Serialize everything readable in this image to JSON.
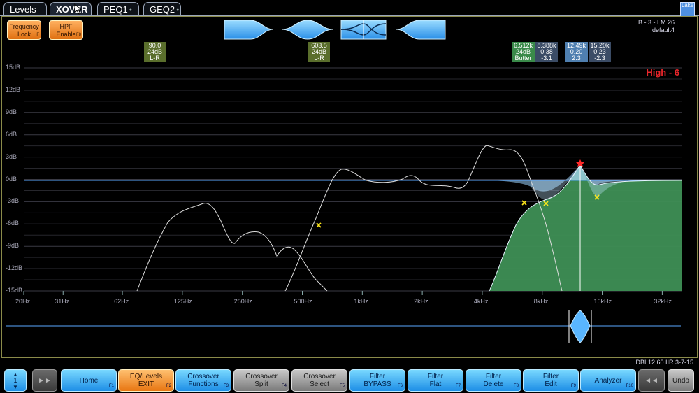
{
  "tabs": [
    {
      "label": "Levels",
      "active": false,
      "dot": false
    },
    {
      "label": "XOVER",
      "active": true,
      "dot": false
    },
    {
      "label": "PEQ1",
      "active": false,
      "dot": true
    },
    {
      "label": "GEQ2",
      "active": false,
      "dot": true
    }
  ],
  "logo_text": "Lake",
  "top_buttons": {
    "freq_lock": {
      "line1": "Frequency",
      "line2": "Lock",
      "fkey": "F"
    },
    "hpf_enable": {
      "line1": "HPF",
      "line2": "Enable",
      "fkey": "F8"
    }
  },
  "module_info": {
    "name": "B - 3 - LM 26",
    "preset": "default4"
  },
  "high_label": "High - 6",
  "crossover_boxes": [
    {
      "l1": "90.0",
      "l2": "24dB",
      "l3": "L-R"
    },
    {
      "l1": "603.5",
      "l2": "24dB",
      "l3": "L-R"
    },
    {
      "l1": "6.512k",
      "l2": "24dB",
      "l3": "Butter"
    },
    {
      "l1": "8.388k",
      "l2": "0.38",
      "l3": "-3.1"
    },
    {
      "l1": "12.49k",
      "l2": "0.20",
      "l3": "2.3"
    },
    {
      "l1": "15.20k",
      "l2": "0.23",
      "l3": "-2.3"
    }
  ],
  "y_axis_labels": [
    "15dB",
    "12dB",
    "9dB",
    "6dB",
    "3dB",
    "0dB",
    "-3dB",
    "-6dB",
    "-9dB",
    "-12dB",
    "-15dB"
  ],
  "x_axis_labels": [
    "20Hz",
    "31Hz",
    "62Hz",
    "125Hz",
    "250Hz",
    "500Hz",
    "1kHz",
    "2kHz",
    "4kHz",
    "8kHz",
    "16kHz",
    "32kHz"
  ],
  "status_text": "DBL12 60 IIR 3-7-15",
  "function_buttons": [
    {
      "line1": "",
      "line2": "",
      "fkey": "",
      "style": "updown"
    },
    {
      "line1": "►►",
      "line2": "",
      "fkey": "",
      "style": "dark"
    },
    {
      "line1": "Home",
      "line2": "",
      "fkey": "F1",
      "style": "blue"
    },
    {
      "line1": "EQ/Levels",
      "line2": "EXIT",
      "fkey": "F2",
      "style": "orange"
    },
    {
      "line1": "Crossover",
      "line2": "Functions",
      "fkey": "F3",
      "style": "blue"
    },
    {
      "line1": "Crossover",
      "line2": "Split",
      "fkey": "F4",
      "style": "gray"
    },
    {
      "line1": "Crossover",
      "line2": "Select",
      "fkey": "F5",
      "style": "gray"
    },
    {
      "line1": "Filter",
      "line2": "BYPASS",
      "fkey": "F6",
      "style": "blue"
    },
    {
      "line1": "Filter",
      "line2": "Flat",
      "fkey": "F7",
      "style": "blue"
    },
    {
      "line1": "Filter",
      "line2": "Delete",
      "fkey": "F8",
      "style": "blue"
    },
    {
      "line1": "Filter",
      "line2": "Edit",
      "fkey": "F9",
      "style": "blue"
    },
    {
      "line1": "Analyzer",
      "line2": "",
      "fkey": "F10",
      "style": "blue"
    },
    {
      "line1": "◄◄",
      "line2": "",
      "fkey": "",
      "style": "dark"
    },
    {
      "line1": "Undo",
      "line2": "",
      "fkey": "",
      "style": "gray"
    }
  ],
  "updown_value": "1",
  "colors": {
    "accent_blue": "#5ab4ff",
    "green_fill": "#3e8f55",
    "orange": "#f08a20",
    "red_label": "#e8262b"
  }
}
